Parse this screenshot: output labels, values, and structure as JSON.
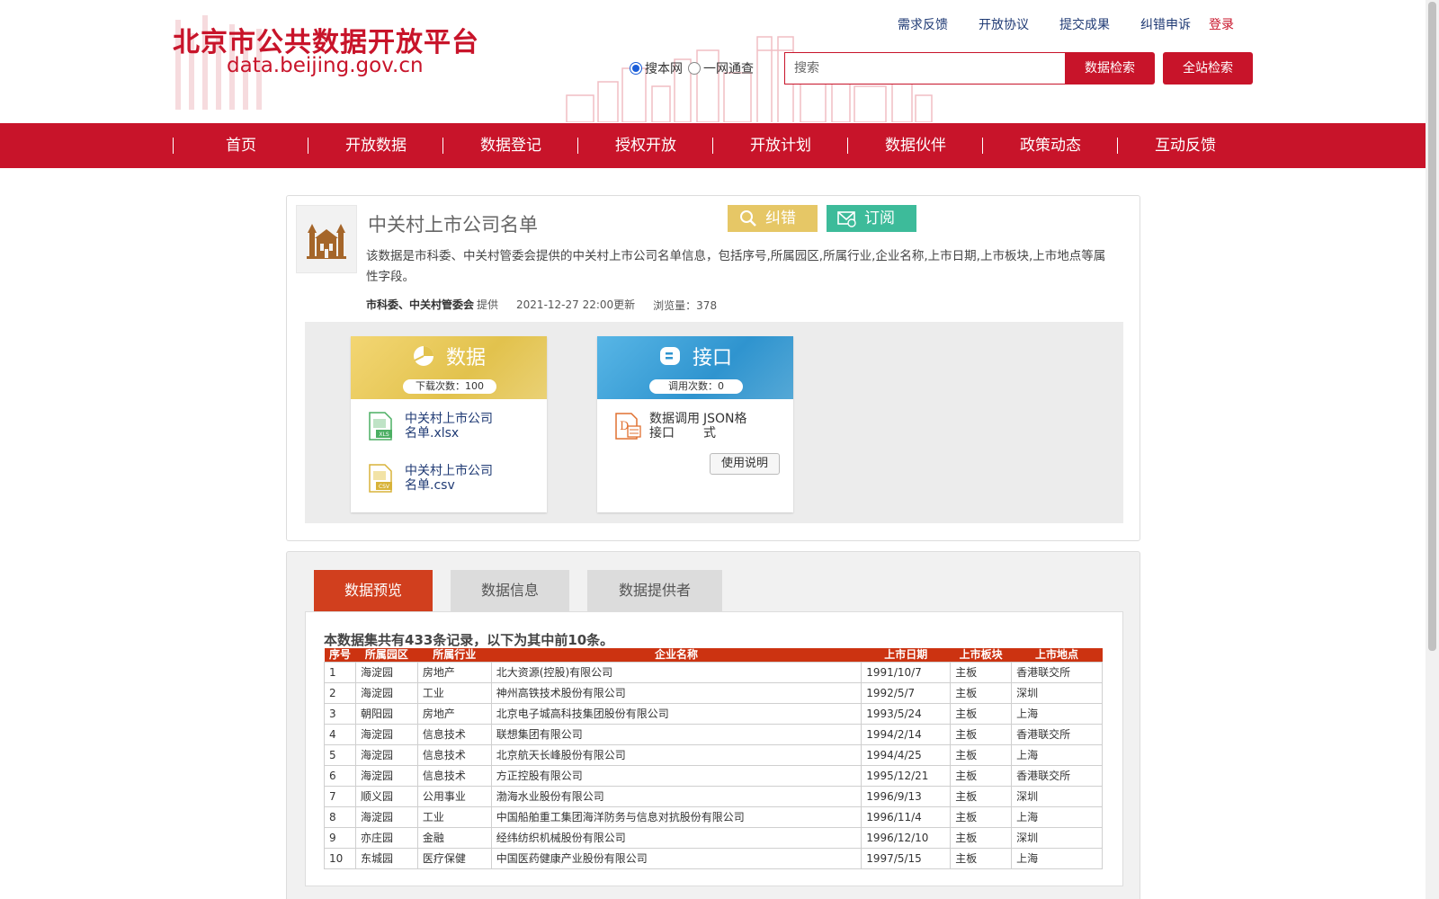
{
  "header": {
    "logo_cn": "北京市公共数据开放平台",
    "logo_en": "data.beijing.gov.cn",
    "top_links": [
      "需求反馈",
      "开放协议",
      "提交成果",
      "纠错申诉"
    ],
    "login": "登录",
    "search_scope": [
      {
        "label": "搜本网",
        "checked": true
      },
      {
        "label": "一网通查",
        "checked": false
      }
    ],
    "search_placeholder": "搜索",
    "search_button": "数据检索",
    "site_search_button": "全站检索",
    "brand_color": "#c8142a"
  },
  "nav": {
    "items": [
      "首页",
      "开放数据",
      "数据登记",
      "授权开放",
      "开放计划",
      "数据伙伴",
      "政策动态",
      "互动反馈"
    ]
  },
  "dataset": {
    "title": "中关村上市公司名单",
    "correct_button": "纠错",
    "subscribe_button": "订阅",
    "description": "该数据是市科委、中关村管委会提供的中关村上市公司名单信息，包括序号,所属园区,所属行业,企业名称,上市日期,上市板块,上市地点等属性字段。",
    "provider": "市科委、中关村管委会",
    "provider_suffix": "提供",
    "updated": "2021-12-27 22:00更新",
    "views": "浏览量：378",
    "data_panel": {
      "title": "数据",
      "count": "下载次数：100",
      "files": [
        {
          "name": "中关村上市公司名单.xlsx",
          "icon": "xls-file-icon"
        },
        {
          "name": "中关村上市公司名单.csv",
          "icon": "csv-file-icon"
        }
      ]
    },
    "api_panel": {
      "title": "接口",
      "count": "调用次数：0",
      "api_name": "数据调用接口",
      "format": "JSON格式",
      "usage_button": "使用说明"
    }
  },
  "preview": {
    "tabs": [
      {
        "label": "数据预览",
        "active": true
      },
      {
        "label": "数据信息",
        "active": false
      },
      {
        "label": "数据提供者",
        "active": false
      }
    ],
    "summary": "本数据集共有433条记录，以下为其中前10条。",
    "columns": [
      "序号",
      "所属园区",
      "所属行业",
      "企业名称",
      "上市日期",
      "上市板块",
      "上市地点"
    ],
    "rows": [
      [
        "1",
        "海淀园",
        "房地产",
        "北大资源(控股)有限公司",
        "1991/10/7",
        "主板",
        "香港联交所"
      ],
      [
        "2",
        "海淀园",
        "工业",
        "神州高铁技术股份有限公司",
        "1992/5/7",
        "主板",
        "深圳"
      ],
      [
        "3",
        "朝阳园",
        "房地产",
        "北京电子城高科技集团股份有限公司",
        "1993/5/24",
        "主板",
        "上海"
      ],
      [
        "4",
        "海淀园",
        "信息技术",
        "联想集团有限公司",
        "1994/2/14",
        "主板",
        "香港联交所"
      ],
      [
        "5",
        "海淀园",
        "信息技术",
        "北京航天长峰股份有限公司",
        "1994/4/25",
        "主板",
        "上海"
      ],
      [
        "6",
        "海淀园",
        "信息技术",
        "方正控股有限公司",
        "1995/12/21",
        "主板",
        "香港联交所"
      ],
      [
        "7",
        "顺义园",
        "公用事业",
        "渤海水业股份有限公司",
        "1996/9/13",
        "主板",
        "深圳"
      ],
      [
        "8",
        "海淀园",
        "工业",
        "中国船舶重工集团海洋防务与信息对抗股份有限公司",
        "1996/11/4",
        "主板",
        "上海"
      ],
      [
        "9",
        "亦庄园",
        "金融",
        "经纬纺织机械股份有限公司",
        "1996/12/10",
        "主板",
        "深圳"
      ],
      [
        "10",
        "东城园",
        "医疗保健",
        "中国医药健康产业股份有限公司",
        "1997/5/15",
        "主板",
        "上海"
      ]
    ]
  }
}
